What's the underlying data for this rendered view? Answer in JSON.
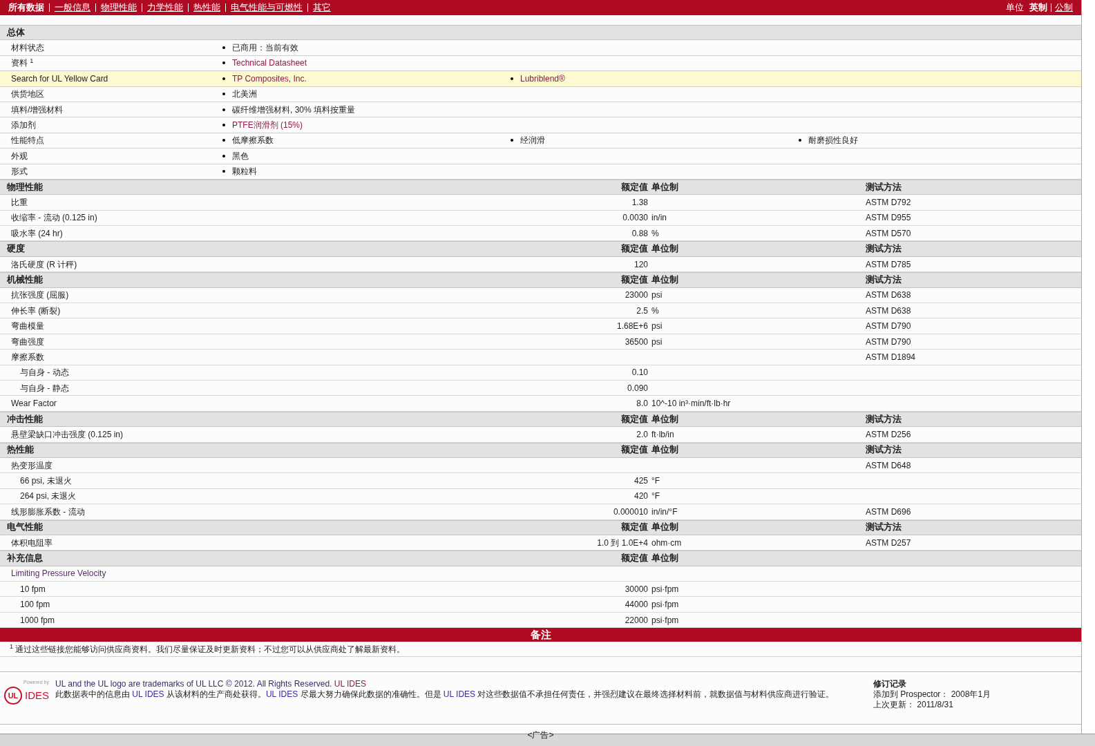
{
  "nav": {
    "tabs": [
      {
        "label": "所有数据",
        "selected": true
      },
      {
        "label": "一般信息",
        "selected": false
      },
      {
        "label": "物理性能",
        "selected": false
      },
      {
        "label": "力学性能",
        "selected": false
      },
      {
        "label": "热性能",
        "selected": false
      },
      {
        "label": "电气性能与可燃性",
        "selected": false
      },
      {
        "label": "其它",
        "selected": false
      }
    ],
    "units_label": "单位",
    "units": [
      {
        "label": "英制",
        "selected": true
      },
      {
        "label": "公制",
        "selected": false
      }
    ]
  },
  "general": {
    "title": "总体",
    "rows": [
      {
        "label": "材料状态",
        "highlighted": false,
        "values": [
          {
            "text": "已商用：当前有效",
            "kind": "text"
          }
        ]
      },
      {
        "label": "资料 $^{1}$",
        "highlighted": false,
        "values": [
          {
            "text": "Technical Datasheet",
            "kind": "link"
          }
        ]
      },
      {
        "label": "Search for UL Yellow Card",
        "highlighted": true,
        "values": [
          {
            "text": "TP Composites, Inc.",
            "kind": "link"
          },
          {
            "text": "Lubriblend®",
            "kind": "link"
          }
        ]
      },
      {
        "label": "供货地区",
        "highlighted": false,
        "values": [
          {
            "text": "北美洲",
            "kind": "text"
          }
        ]
      },
      {
        "label": "填料/增强材料",
        "highlighted": false,
        "values": [
          {
            "text": "碳纤维增强材料, 30% 填料按重量",
            "kind": "text"
          }
        ]
      },
      {
        "label": "添加剂",
        "highlighted": false,
        "values": [
          {
            "text": "PTFE润滑剂 (15%)",
            "kind": "link"
          }
        ]
      },
      {
        "label": "性能特点",
        "highlighted": false,
        "values": [
          {
            "text": "低摩擦系数",
            "kind": "text"
          },
          {
            "text": "经润滑",
            "kind": "text"
          },
          {
            "text": "耐磨损性良好",
            "kind": "text"
          }
        ]
      },
      {
        "label": "外观",
        "highlighted": false,
        "values": [
          {
            "text": "黑色",
            "kind": "text"
          }
        ]
      },
      {
        "label": "形式",
        "highlighted": false,
        "values": [
          {
            "text": "颗粒料",
            "kind": "text"
          }
        ]
      }
    ]
  },
  "sections": [
    {
      "title": "物理性能",
      "headers": [
        "额定值",
        "单位制",
        "测试方法"
      ],
      "rows": [
        {
          "label": "比重",
          "value": "1.38",
          "method": "ASTM D792"
        },
        {
          "label": "收缩率 - 流动 (0.125 in)",
          "value": "0.0030",
          "unit": "in/in",
          "method": "ASTM D955"
        },
        {
          "label": "吸水率 (24 hr)",
          "value": "0.88",
          "unit": "%",
          "method": "ASTM D570"
        }
      ]
    },
    {
      "title": "硬度",
      "headers": [
        "额定值",
        "单位制",
        "测试方法"
      ],
      "rows": [
        {
          "label": "洛氏硬度 (R 计秤)",
          "value": "120",
          "method": "ASTM D785"
        }
      ]
    },
    {
      "title": "机械性能",
      "headers": [
        "额定值",
        "单位制",
        "测试方法"
      ],
      "rows": [
        {
          "label": "抗张强度 (屈服)",
          "value": "23000",
          "unit": "psi",
          "method": "ASTM D638"
        },
        {
          "label": "伸长率 (断裂)",
          "value": "2.5",
          "unit": "%",
          "method": "ASTM D638"
        },
        {
          "label": "弯曲模量",
          "value": "1.68E+6",
          "unit": "psi",
          "method": "ASTM D790"
        },
        {
          "label": "弯曲强度",
          "value": "36500",
          "unit": "psi",
          "method": "ASTM D790"
        },
        {
          "label": "摩擦系数",
          "method": "ASTM D1894",
          "children": [
            {
              "label": "与自身 - 动态",
              "value": "0.10"
            },
            {
              "label": "与自身 - 静态",
              "value": "0.090"
            }
          ]
        },
        {
          "label": "Wear Factor",
          "value": "8.0",
          "unit": "10^-10 in³·min/ft·lb·hr"
        }
      ]
    },
    {
      "title": "冲击性能",
      "headers": [
        "额定值",
        "单位制",
        "测试方法"
      ],
      "rows": [
        {
          "label": "悬壁梁缺口冲击强度 (0.125 in)",
          "value": "2.0",
          "unit": "ft·lb/in",
          "method": "ASTM D256"
        }
      ]
    },
    {
      "title": "热性能",
      "headers": [
        "额定值",
        "单位制",
        "测试方法"
      ],
      "rows": [
        {
          "label": "热变形温度",
          "method": "ASTM D648",
          "children": [
            {
              "label": "66 psi, 未退火",
              "value": "425",
              "unit": "°F"
            },
            {
              "label": "264 psi, 未退火",
              "value": "420",
              "unit": "°F"
            }
          ]
        },
        {
          "label": "线形膨胀系数 - 流动",
          "value": "0.000010",
          "unit": "in/in/°F",
          "method": "ASTM D696"
        }
      ]
    },
    {
      "title": "电气性能",
      "headers": [
        "额定值",
        "单位制",
        "测试方法"
      ],
      "rows": [
        {
          "label": "体积电阻率",
          "value": "1.0 到 1.0E+4",
          "unit": "ohm·cm",
          "method": "ASTM D257"
        }
      ]
    },
    {
      "title": "补充信息",
      "headers": [
        "额定值",
        "单位制"
      ],
      "rows": [
        {
          "label": "Limiting Pressure Velocity",
          "kind": "link",
          "children": [
            {
              "label": "10 fpm",
              "value": "30000",
              "unit": "psi·fpm"
            },
            {
              "label": "100 fpm",
              "value": "44000",
              "unit": "psi·fpm"
            },
            {
              "label": "1000 fpm",
              "value": "22000",
              "unit": "psi·fpm"
            }
          ]
        }
      ]
    }
  ],
  "notes": {
    "title": "备注",
    "items": [
      "$^{1}$ 通过这些链接您能够访问供应商资料。我们尽量保证及时更新资料；不过您可以从供应商处了解最新资料。"
    ]
  },
  "footer": {
    "logo": {
      "powered": "Powered by",
      "mark": "UL",
      "name": "IDES"
    },
    "trademark": "UL and the UL logo are trademarks of UL LLC © 2012. All Rights Reserved.",
    "trademark_link": "UL IDES",
    "disclaimer": [
      {
        "text": "此数据表中的信息由 ",
        "link": false
      },
      {
        "text": "UL IDES",
        "link": true
      },
      {
        "text": " 从该材料的生产商处获得。",
        "link": false
      },
      {
        "text": "UL IDES",
        "link": true
      },
      {
        "text": " 尽最大努力确保此数据的准确性。但是 ",
        "link": false
      },
      {
        "text": "UL IDES",
        "link": true
      },
      {
        "text": " 对这些数据值不承担任何责任，并强烈建议在最终选择材料前，就数据值与材料供应商进行验证。",
        "link": false
      }
    ],
    "revision": {
      "title": "修订记录",
      "lines": [
        "添加到 Prospector： 2008年1月",
        "上次更新： 2011/8/31"
      ]
    }
  },
  "ad": "<广告>"
}
